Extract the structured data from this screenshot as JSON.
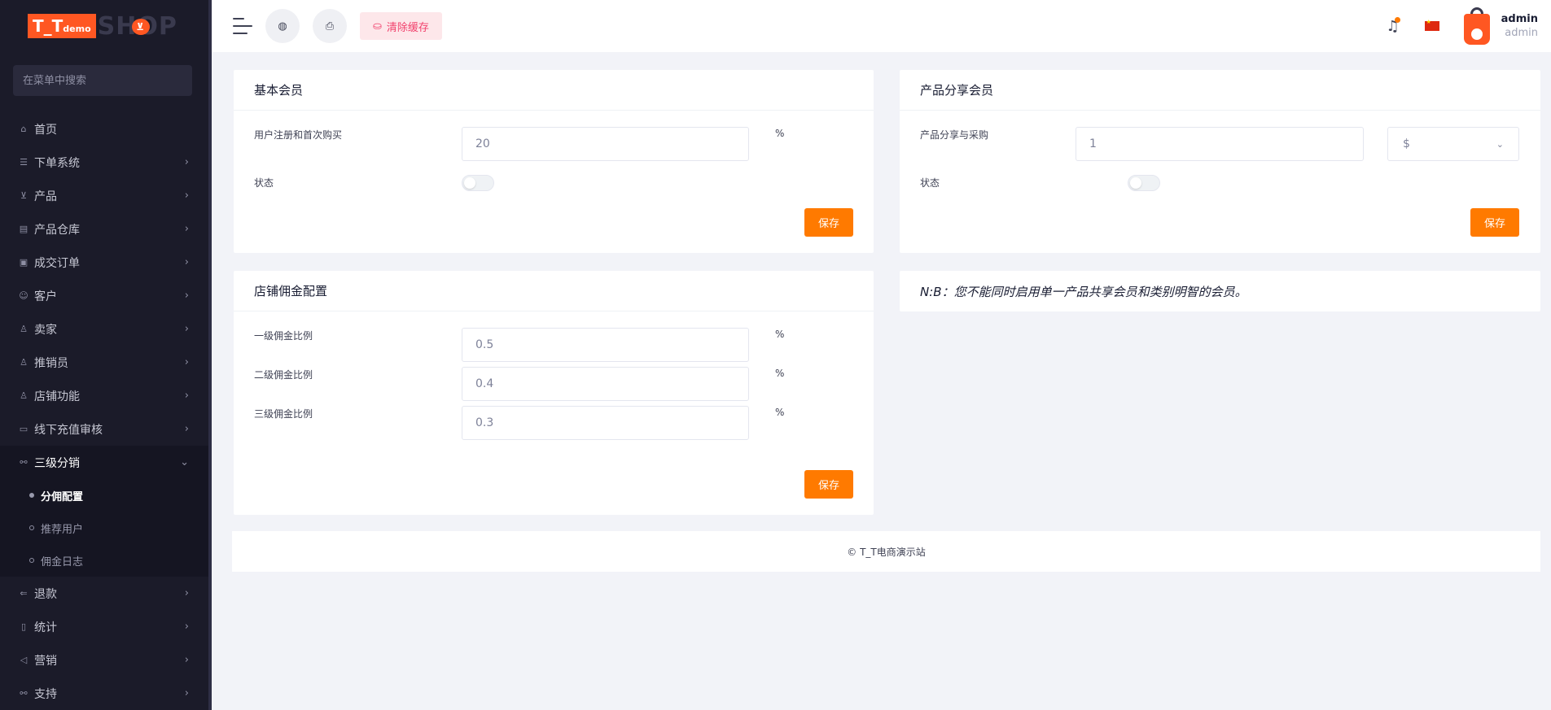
{
  "logo": {
    "prefix": "T_T",
    "suffix": "demo",
    "brand": "SHOP"
  },
  "sidebar": {
    "search_placeholder": "在菜单中搜索",
    "items": [
      {
        "label": "首页",
        "icon": "home-icon",
        "glyph": "⌂",
        "chevron": false
      },
      {
        "label": "下单系统",
        "icon": "list-icon",
        "glyph": "☰",
        "chevron": true
      },
      {
        "label": "产品",
        "icon": "cart-icon",
        "glyph": "⊻",
        "chevron": true
      },
      {
        "label": "产品仓库",
        "icon": "warehouse-icon",
        "glyph": "▤",
        "chevron": true
      },
      {
        "label": "成交订单",
        "icon": "money-icon",
        "glyph": "▣",
        "chevron": true
      },
      {
        "label": "客户",
        "icon": "users-icon",
        "glyph": "☺",
        "chevron": true
      },
      {
        "label": "卖家",
        "icon": "user-icon",
        "glyph": "♙",
        "chevron": true
      },
      {
        "label": "推销员",
        "icon": "user-icon",
        "glyph": "♙",
        "chevron": true
      },
      {
        "label": "店铺功能",
        "icon": "user-icon",
        "glyph": "♙",
        "chevron": true
      },
      {
        "label": "线下充值审核",
        "icon": "cash-icon",
        "glyph": "▭",
        "chevron": true
      }
    ],
    "active_parent": {
      "label": "三级分销",
      "icon": "link-icon",
      "glyph": "⚯"
    },
    "sub_items": [
      {
        "label": "分佣配置",
        "active": true
      },
      {
        "label": "推荐用户",
        "active": false
      },
      {
        "label": "佣金日志",
        "active": false
      }
    ],
    "after_items": [
      {
        "label": "退款",
        "icon": "refund-icon",
        "glyph": "⇐"
      },
      {
        "label": "统计",
        "icon": "document-icon",
        "glyph": "▯"
      },
      {
        "label": "营销",
        "icon": "megaphone-icon",
        "glyph": "◁"
      },
      {
        "label": "支持",
        "icon": "link-icon",
        "glyph": "⚯"
      }
    ]
  },
  "header": {
    "clear_cache_label": "清除缓存",
    "user_name": "admin",
    "user_role": "admin"
  },
  "basic_member": {
    "title": "基本会员",
    "field_label": "用户注册和首次购买",
    "field_value": "20",
    "unit": "%",
    "status_label": "状态",
    "save_label": "保存"
  },
  "product_share": {
    "title": "产品分享会员",
    "field_label": "产品分享与采购",
    "field_value": "1",
    "currency": "$",
    "status_label": "状态",
    "save_label": "保存"
  },
  "commission": {
    "title": "店铺佣金配置",
    "levels": [
      {
        "label": "一级佣金比例",
        "value": "0.5",
        "unit": "%"
      },
      {
        "label": "二级佣金比例",
        "value": "0.4",
        "unit": "%"
      },
      {
        "label": "三级佣金比例",
        "value": "0.3",
        "unit": "%"
      }
    ],
    "save_label": "保存"
  },
  "note": "N:B：您不能同时启用单一产品共享会员和类别明智的会员。",
  "footer": "© T_T电商演示站",
  "colors": {
    "accent": "#ff7a00",
    "sidebar_bg": "#1b1b29",
    "danger_light": "#fde7ea",
    "danger": "#f1416c"
  }
}
